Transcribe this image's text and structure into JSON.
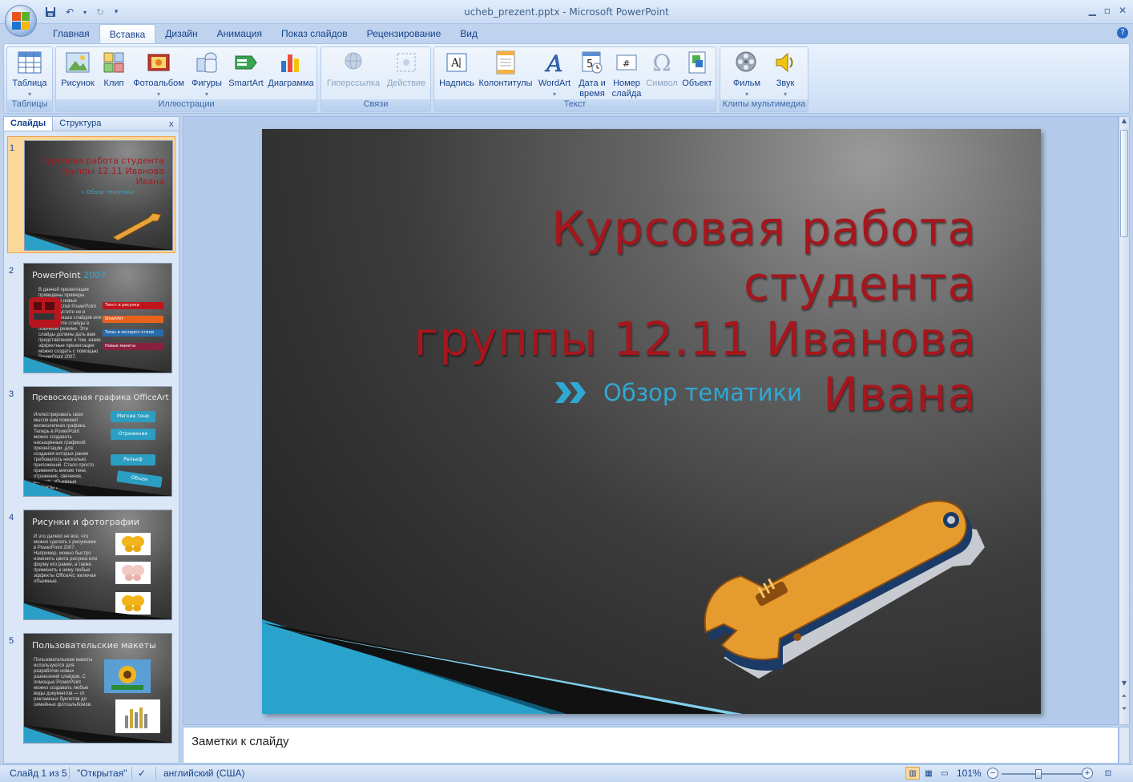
{
  "window": {
    "title": "ucheb_prezent.pptx - Microsoft PowerPoint"
  },
  "tabs": [
    {
      "label": "Главная",
      "active": false
    },
    {
      "label": "Вставка",
      "active": true
    },
    {
      "label": "Дизайн",
      "active": false
    },
    {
      "label": "Анимация",
      "active": false
    },
    {
      "label": "Показ слайдов",
      "active": false
    },
    {
      "label": "Рецензирование",
      "active": false
    },
    {
      "label": "Вид",
      "active": false
    }
  ],
  "ribbon": {
    "groups": {
      "tables": "Таблицы",
      "illustrations": "Иллюстрации",
      "links": "Связи",
      "text": "Текст",
      "media": "Клипы мультимедиа"
    },
    "buttons": {
      "table": "Таблица",
      "picture": "Рисунок",
      "clip": "Клип",
      "album": "Фотоальбом",
      "shapes": "Фигуры",
      "smartart": "SmartArt",
      "chart": "Диаграмма",
      "hyperlink": "Гиперссылка",
      "action": "Действие",
      "textbox": "Надпись",
      "headerfooter": "Колонтитулы",
      "wordart": "WordArt",
      "datetime_1": "Дата и",
      "datetime_2": "время",
      "slidenum_1": "Номер",
      "slidenum_2": "слайда",
      "symbol": "Символ",
      "object": "Объект",
      "movie": "Фильм",
      "sound": "Звук"
    }
  },
  "left_pane": {
    "tab_slides": "Слайды",
    "tab_outline": "Структура",
    "close": "x",
    "thumbs": [
      {
        "num": "1",
        "title": "Курсовая работа студента группы 12.11 Иванова Ивана",
        "subtitle": "Обзор тематики"
      },
      {
        "num": "2",
        "title": "PowerPoint",
        "title_hl": "2007",
        "text": "В данной презентации приведены примеры некоторых новых возможностей PowerPoint 2007. Запустите ее в режиме показа слайдов или просмотрите слайды в обычном режиме. Эти слайды должны дать вам представление о том, какие эффектные презентации можно создать с помощью PowerPoint 2007.",
        "bars": [
          "Текст и рисунки",
          "SmartArt",
          "Темы и экспресс-стили",
          "Новые макеты"
        ]
      },
      {
        "num": "3",
        "title": "Превосходная графика OfficeArt",
        "text": "Иллюстрировать свои мысли вам поможет великолепная графика. Теперь в PowerPoint можно создавать насыщенные графикой презентации, для создания которых ранее требовалось несколько приложений. Стало просто применять мягкие тени, отражение, свечение, рельеф, объемные эффекты и многое другое.",
        "buttons": [
          "Мягкие тени",
          "Отражение",
          "Рельеф",
          "Объем"
        ]
      },
      {
        "num": "4",
        "title": "Рисунки и фотографии",
        "text": "И это далеко не все, что можно сделать с рисунками в PowerPoint 2007. Например, можно быстро изменить цвета рисунка или форму его рамки, а также применить к нему любые эффекты OfficeArt, включая объемные."
      },
      {
        "num": "5",
        "title": "Пользовательские макеты",
        "text": "Пользовательские макеты используются для разработки новых разнесений слайдов. С помощью PowerPoint можно создавать любые виды документов — от рекламных буклетов до семейных фотоальбомов."
      }
    ]
  },
  "slide": {
    "title_1": "Курсовая работа студента",
    "title_2": "группы 12.11 Иванова",
    "title_3": "Ивана",
    "subtitle": "Обзор тематики"
  },
  "notes": {
    "placeholder": "Заметки к слайду"
  },
  "status": {
    "slide_info": "Слайд 1 из 5",
    "theme": "\"Открытая\"",
    "language": "английский (США)",
    "zoom": "101%",
    "zoom_level": 101
  },
  "colors": {
    "title_red": "#a5161d",
    "accent_blue": "#2fa8d4",
    "selected_thumb": "#fcd79a"
  }
}
